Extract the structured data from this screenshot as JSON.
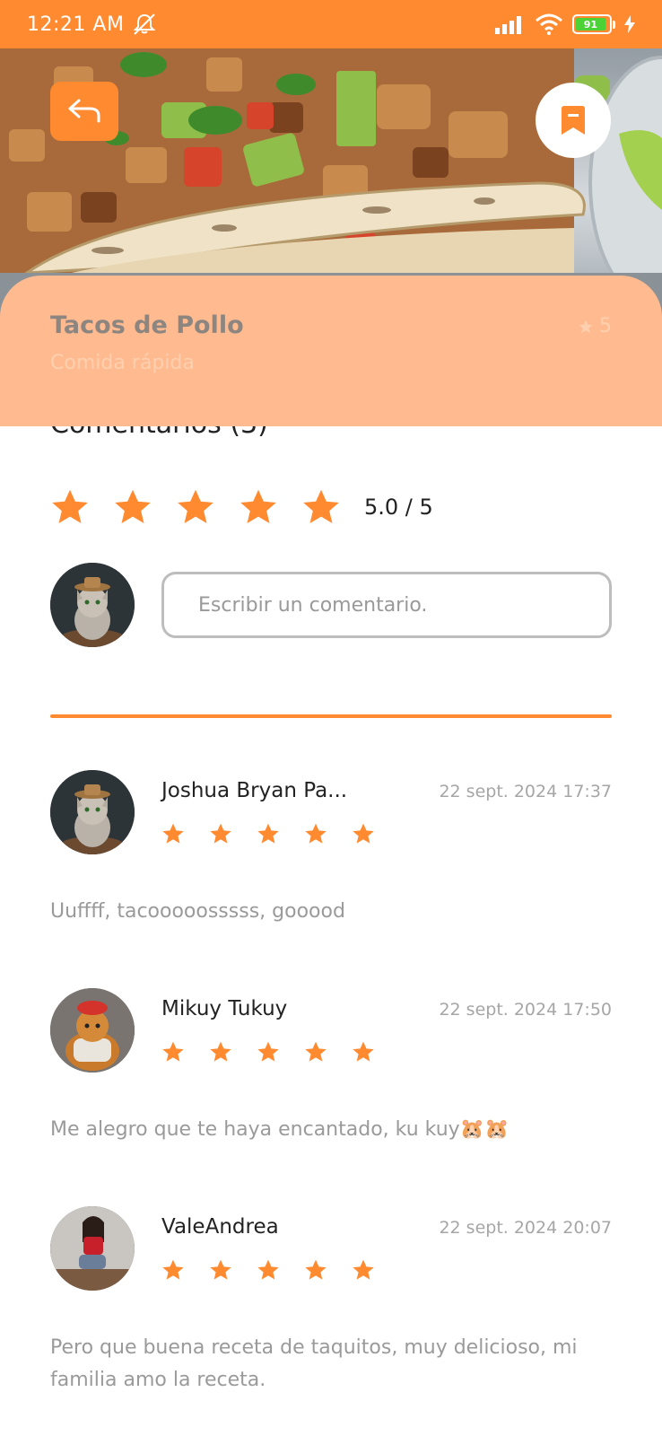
{
  "status_bar": {
    "time": "12:21 AM",
    "battery": "91",
    "icons": [
      "mute-icon",
      "signal-icon",
      "wifi-icon",
      "battery-icon",
      "charging-icon"
    ]
  },
  "recipe": {
    "title": "Tacos de Pollo",
    "category": "Comida rápida",
    "rating": "5"
  },
  "comments_section": {
    "header": "Comentarios (3)",
    "average_rating": "5.0 / 5",
    "stars": 5,
    "input_placeholder": "Escribir un comentario."
  },
  "comments": [
    {
      "author": "Joshua Bryan Pa...",
      "date": "22 sept. 2024 17:37",
      "stars": 5,
      "text": "Uuffff, tacooooosssss, gooood"
    },
    {
      "author": "Mikuy Tukuy",
      "date": "22 sept. 2024 17:50",
      "stars": 5,
      "text": "Me alegro que te haya encantado, ku kuy🐹🐹"
    },
    {
      "author": "ValeAndrea",
      "date": "22 sept. 2024 20:07",
      "stars": 5,
      "text": "Pero que buena receta de taquitos, muy delicioso, mi familia amo la receta."
    }
  ],
  "colors": {
    "accent": "#ff8a30",
    "title_card": "#ffbb8f",
    "muted_text": "#9a9a9a"
  }
}
